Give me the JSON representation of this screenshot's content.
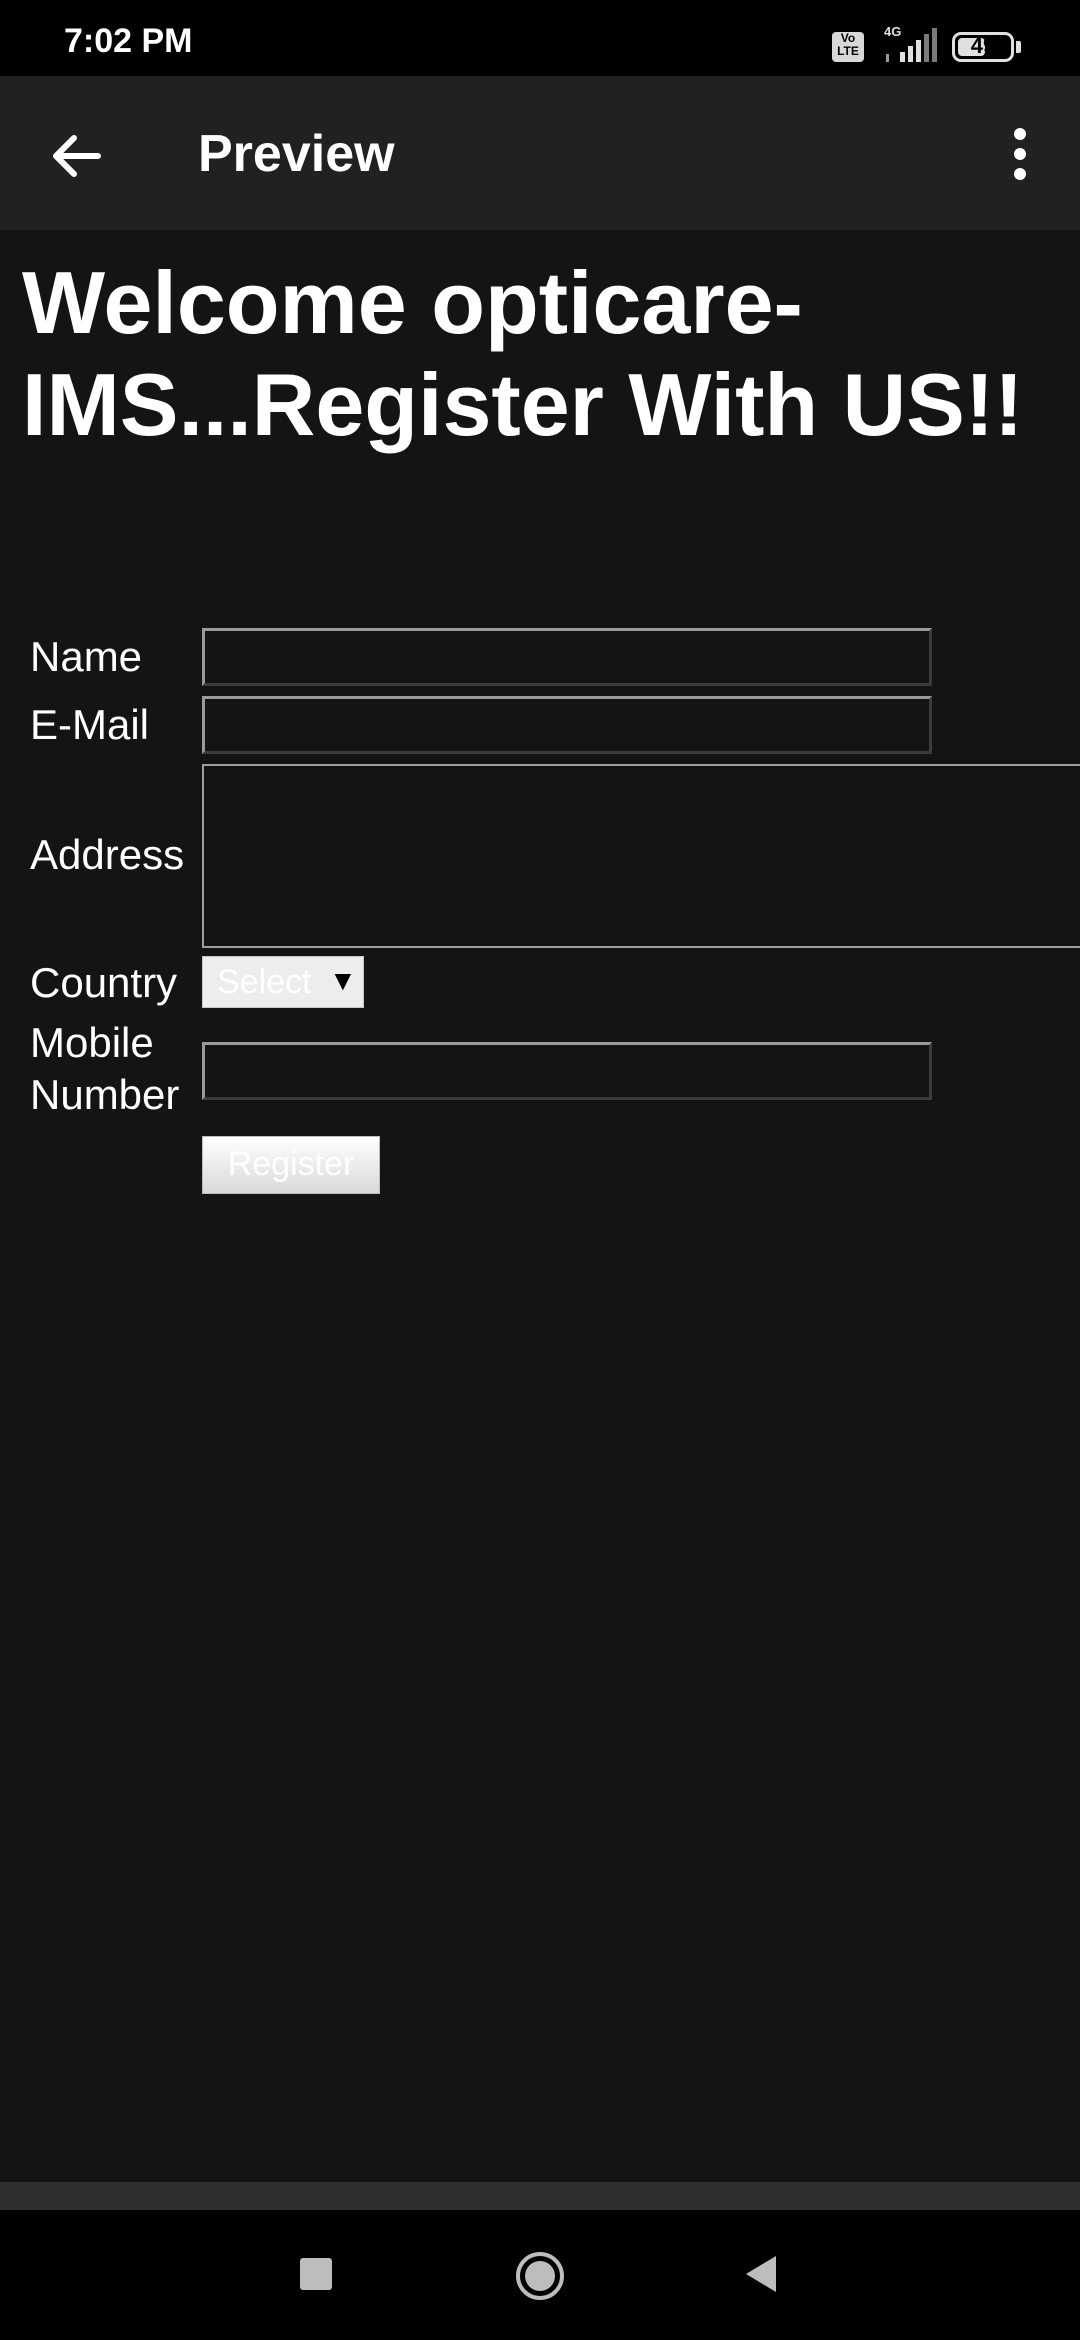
{
  "status_bar": {
    "time": "7:02 PM",
    "volte_label": "Vo LTE",
    "network": "4G",
    "battery": "49"
  },
  "app_bar": {
    "title": "Preview"
  },
  "page": {
    "heading": "Welcome opticare-IMS...Register With US!!"
  },
  "form": {
    "name_label": "Name",
    "email_label": "E-Mail",
    "address_label": "Address",
    "country_label": "Country",
    "country_selected": "Select",
    "mobile_label_line1": "Mobile",
    "mobile_label_line2": "Number",
    "register_label": "Register"
  },
  "icons": {
    "back": "arrow-left",
    "more": "more-vert",
    "nav_recent": "square",
    "nav_home": "circle",
    "nav_back": "triangle-left"
  }
}
